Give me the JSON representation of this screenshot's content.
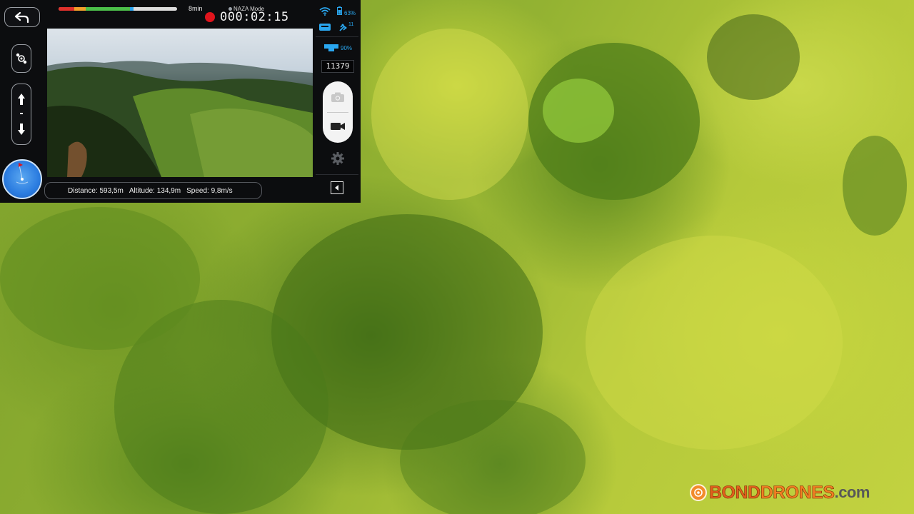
{
  "top_bar": {
    "flight_time_left": "8min",
    "mode": "NAZA Mode",
    "record_timer": "000:02:15",
    "battery_level_fraction": 0.62
  },
  "status": {
    "phone_battery": "63%",
    "satellites": "11",
    "aircraft_battery": "90%",
    "altitude_readout": "11379"
  },
  "telemetry": {
    "distance": "Distance: 593,5m",
    "altitude": "Altitude: 134,9m",
    "speed": "Speed: 9,8m/s"
  },
  "watermark": {
    "bond": "BOND",
    "drones": "DRONES",
    "com": ".com"
  },
  "colors": {
    "accent_blue": "#2aa7f0",
    "record_red": "#e0141c",
    "watermark_orange": "#f07f22"
  }
}
